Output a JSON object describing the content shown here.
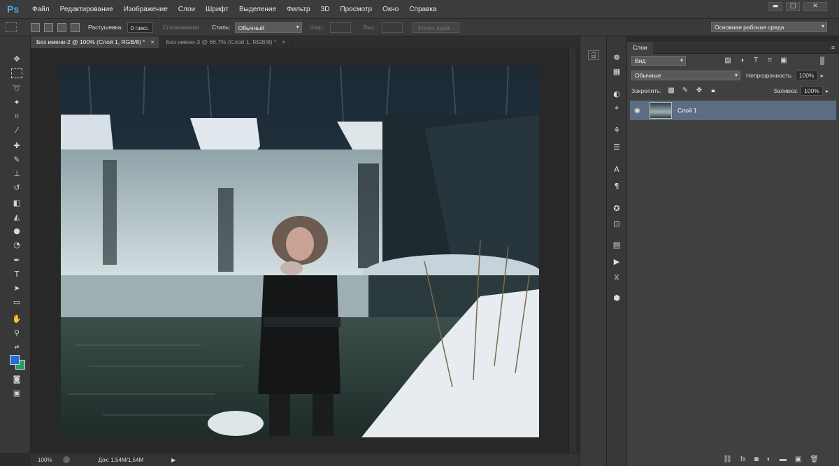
{
  "app": {
    "logo": "Ps"
  },
  "menu": [
    "Файл",
    "Редактирование",
    "Изображение",
    "Слои",
    "Шрифт",
    "Выделение",
    "Фильтр",
    "3D",
    "Просмотр",
    "Окно",
    "Справка"
  ],
  "window_controls": {
    "minimize": "▬",
    "maximize": "□",
    "close": "✕"
  },
  "options": {
    "feather_label": "Растушевка:",
    "feather_value": "0 пикс.",
    "antialias_label": "Сглаживание",
    "style_label": "Стиль:",
    "style_value": "Обычный",
    "width_label": "Шир.:",
    "height_label": "Выс.:",
    "refine_button": "Уточн. край...",
    "workspace": "Основная рабочая среда"
  },
  "tabs": [
    {
      "label": "Без имени-2 @ 100% (Слой 1, RGB/8) *",
      "active": true
    },
    {
      "label": "Без имени-3 @ 66,7% (Слой 1, RGB/8) *",
      "active": false
    }
  ],
  "tab_close": "×",
  "status": {
    "zoom": "100%",
    "doc": "Док: 1,54M/1,54M"
  },
  "layers_panel": {
    "tab": "Слои",
    "filter_kind": "Вид",
    "blend_mode": "Обычные",
    "opacity_label": "Непрозрачность:",
    "opacity_value": "100%",
    "lock_label": "Закрепить:",
    "fill_label": "Заливка:",
    "fill_value": "100%",
    "layers": [
      {
        "name": "Слой 1",
        "visible": true
      }
    ]
  },
  "colors": {
    "foreground": "#1f6fd6",
    "background": "#2aa05a",
    "layer_selected": "#5b6d82"
  }
}
